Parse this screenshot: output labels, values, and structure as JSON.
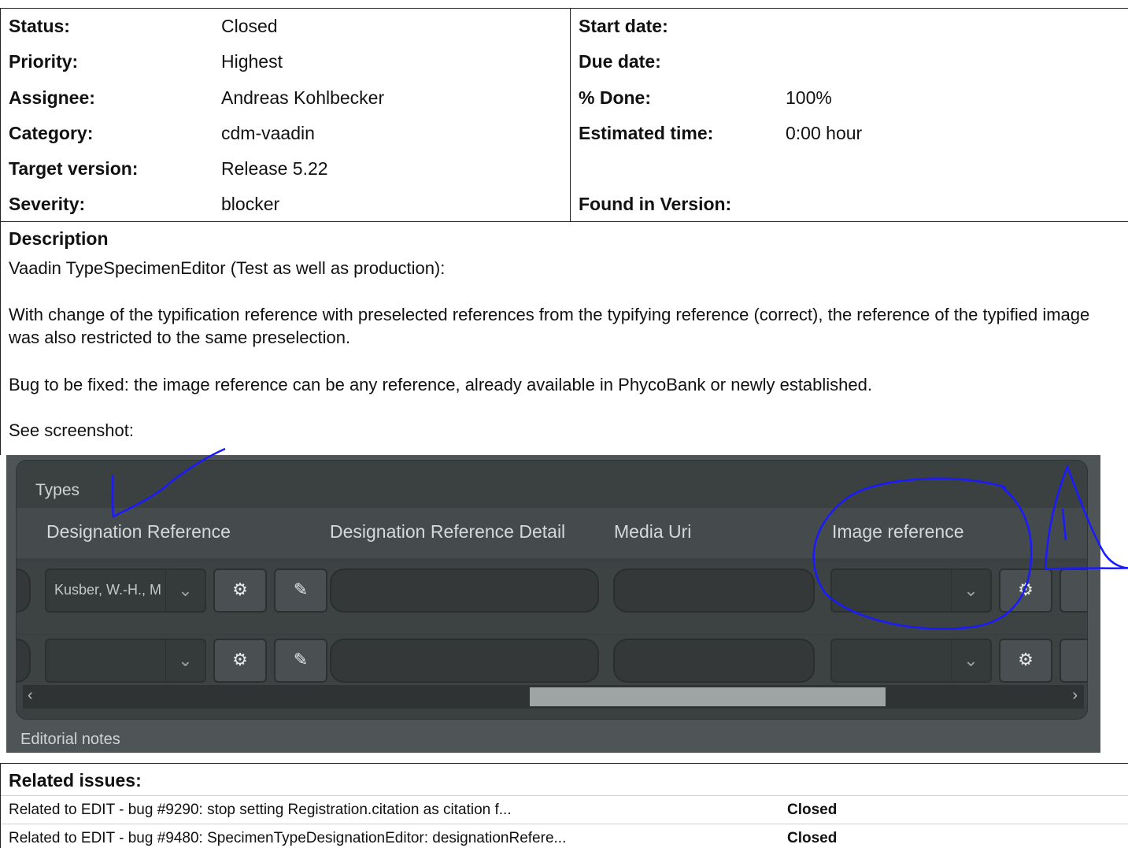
{
  "attributes": {
    "left": [
      {
        "label": "Status:",
        "value": "Closed"
      },
      {
        "label": "Priority:",
        "value": "Highest"
      },
      {
        "label": "Assignee:",
        "value": "Andreas Kohlbecker"
      },
      {
        "label": "Category:",
        "value": "cdm-vaadin"
      },
      {
        "label": "Target version:",
        "value": "Release 5.22"
      },
      {
        "label": "Severity:",
        "value": "blocker"
      }
    ],
    "right": [
      {
        "label": "Start date:",
        "value": ""
      },
      {
        "label": "Due date:",
        "value": ""
      },
      {
        "label": "% Done:",
        "value": "100%"
      },
      {
        "label": "Estimated time:",
        "value": "0:00 hour"
      },
      {
        "label": "",
        "value": ""
      },
      {
        "label": "Found in Version:",
        "value": ""
      }
    ]
  },
  "description": {
    "title": "Description",
    "paragraphs": [
      "Vaadin TypeSpecimenEditor (Test as well as production):",
      "With change of the typification reference with preselected references from the typifying reference (correct), the reference of the typified image was also restricted to the same preselection.",
      "Bug to be fixed: the image reference can be any reference, already available in PhycoBank or newly established.",
      "See screenshot:"
    ]
  },
  "screenshot": {
    "section_title": "Types",
    "columns": [
      "Designation Reference",
      "Designation Reference Detail",
      "Media Uri",
      "Image reference"
    ],
    "row1_reference": "Kusber, W.-H., M",
    "editorial_notes": "Editorial notes",
    "annotation_color": "#1a1aff"
  },
  "related": {
    "title": "Related issues:",
    "items": [
      {
        "subject": "Related to EDIT - bug #9290: stop setting Registration.citation as citation f...",
        "status": "Closed"
      },
      {
        "subject": "Related to EDIT - bug #9480: SpecimenTypeDesignationEditor: designationRefere...",
        "status": "Closed"
      }
    ]
  }
}
